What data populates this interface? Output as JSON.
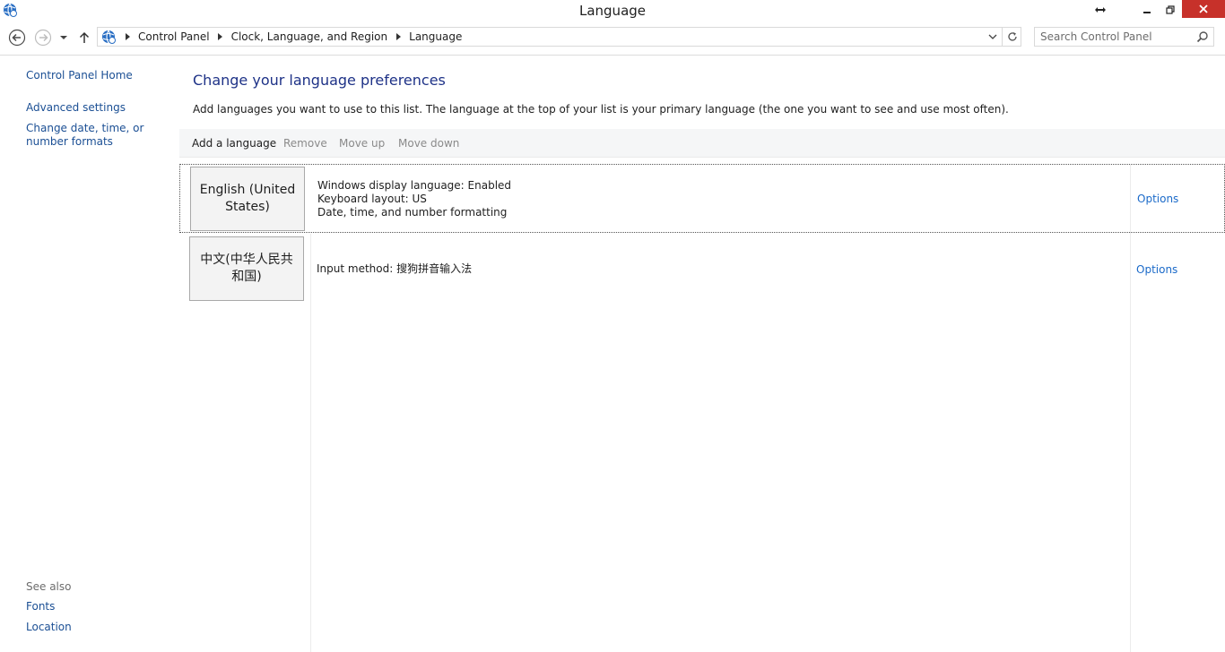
{
  "window": {
    "title": "Language"
  },
  "address_bar": {
    "breadcrumbs": [
      "Control Panel",
      "Clock, Language, and Region",
      "Language"
    ]
  },
  "search": {
    "placeholder": "Search Control Panel"
  },
  "left_pane": {
    "links": [
      "Control Panel Home",
      "Advanced settings",
      "Change date, time, or number formats"
    ],
    "see_also_label": "See also",
    "see_also_links": [
      "Fonts",
      "Location"
    ]
  },
  "main": {
    "title": "Change your language preferences",
    "description": "Add languages you want to use to this list. The language at the top of your list is your primary language (the one you want to see and use most often).",
    "toolbar": {
      "add": "Add a language",
      "remove": "Remove",
      "move_up": "Move up",
      "move_down": "Move down"
    },
    "languages": [
      {
        "name": "English (United States)",
        "details": [
          "Windows display language: Enabled",
          "Keyboard layout: US",
          "Date, time, and number formatting"
        ],
        "options": "Options"
      },
      {
        "name": "中文(中华人民共和国)",
        "details": [
          "Input method: 搜狗拼音输入法"
        ],
        "options": "Options"
      }
    ]
  },
  "icons": {
    "app": "globe-clock-icon",
    "back": "back-arrow-icon",
    "forward": "forward-arrow-icon",
    "up": "up-arrow-icon",
    "refresh": "refresh-icon",
    "search": "search-icon"
  },
  "colors": {
    "link": "#1b4f94",
    "title": "#1e3287",
    "options_link": "#1b6ac9",
    "close_button": "#c7312a"
  }
}
